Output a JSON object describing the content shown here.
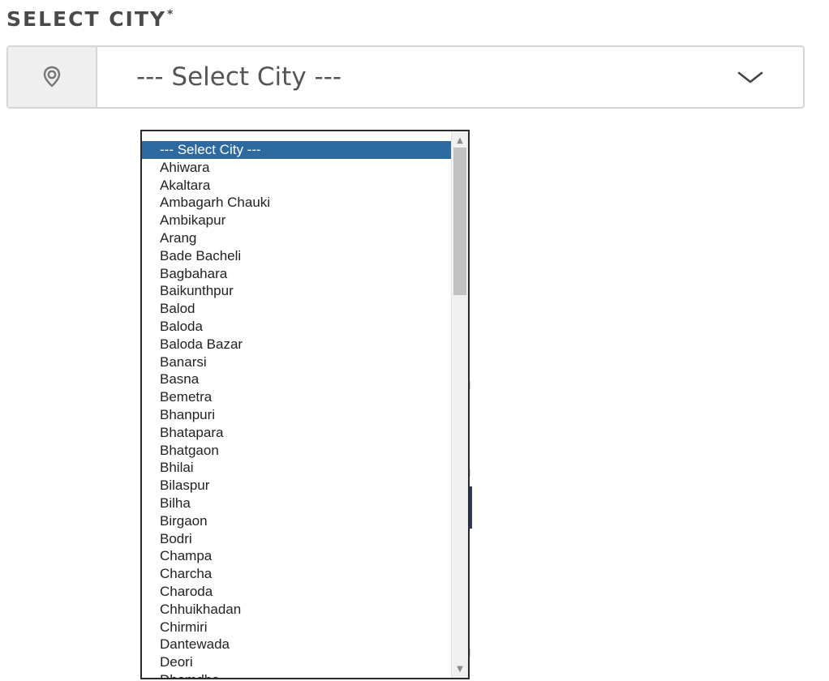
{
  "field": {
    "label": "SELECT CITY",
    "required_marker": "*",
    "icon": "location-pin-icon",
    "selected_value": "--- Select City ---",
    "chevron_icon": "chevron-down-icon"
  },
  "dropdown": {
    "options": [
      {
        "label": "--- Select City ---",
        "selected": true
      },
      {
        "label": "Ahiwara"
      },
      {
        "label": "Akaltara"
      },
      {
        "label": "Ambagarh Chauki"
      },
      {
        "label": "Ambikapur"
      },
      {
        "label": "Arang"
      },
      {
        "label": "Bade Bacheli"
      },
      {
        "label": "Bagbahara"
      },
      {
        "label": "Baikunthpur"
      },
      {
        "label": "Balod"
      },
      {
        "label": "Baloda"
      },
      {
        "label": "Baloda Bazar"
      },
      {
        "label": "Banarsi"
      },
      {
        "label": "Basna"
      },
      {
        "label": "Bemetra"
      },
      {
        "label": "Bhanpuri"
      },
      {
        "label": "Bhatapara"
      },
      {
        "label": "Bhatgaon"
      },
      {
        "label": "Bhilai"
      },
      {
        "label": "Bilaspur"
      },
      {
        "label": "Bilha"
      },
      {
        "label": "Birgaon"
      },
      {
        "label": "Bodri"
      },
      {
        "label": "Champa"
      },
      {
        "label": "Charcha"
      },
      {
        "label": "Charoda"
      },
      {
        "label": "Chhuikhadan"
      },
      {
        "label": "Chirmiri"
      },
      {
        "label": "Dantewada"
      },
      {
        "label": "Deori"
      },
      {
        "label": "Dhamdha"
      }
    ]
  },
  "colors": {
    "selected_option_bg": "#2d6a9f",
    "label_text": "#4a4a4a",
    "icon_cell_bg": "#efefef"
  }
}
